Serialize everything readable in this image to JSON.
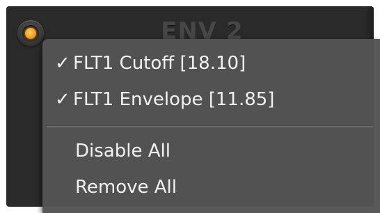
{
  "panel": {
    "title": "ENV 2",
    "led_color": "#f6a21c"
  },
  "menu": {
    "items": [
      {
        "label": "FLT1 Cutoff [18.10]",
        "checked": true,
        "check_glyph": "✓"
      },
      {
        "label": "FLT1 Envelope [11.85]",
        "checked": true,
        "check_glyph": "✓"
      },
      {
        "label": "Disable All",
        "checked": false
      },
      {
        "label": "Remove All",
        "checked": false
      }
    ]
  }
}
